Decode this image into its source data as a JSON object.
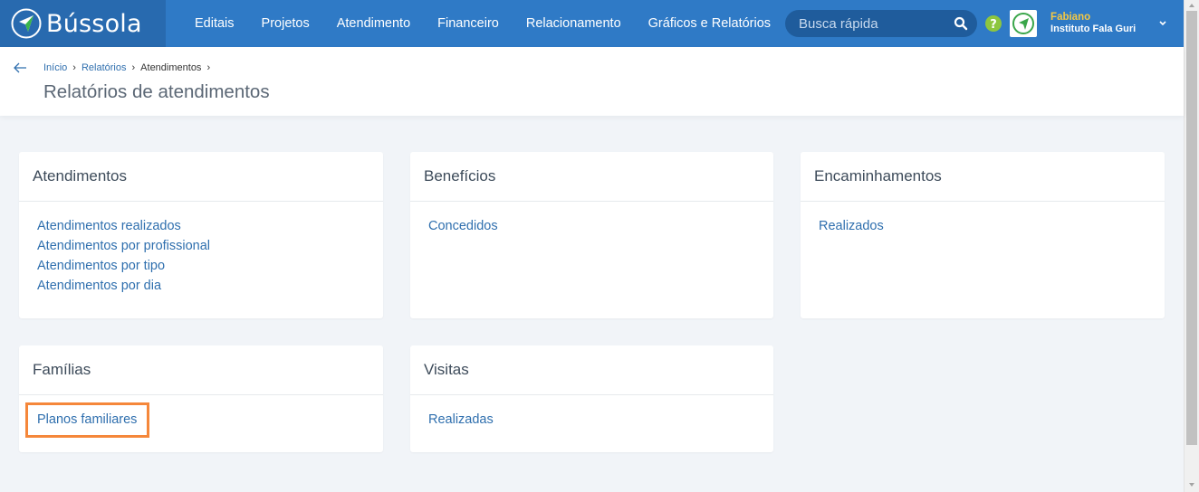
{
  "brand": {
    "name": "Bússola",
    "logo_icon": "compass-icon"
  },
  "nav": {
    "items": [
      "Editais",
      "Projetos",
      "Atendimento",
      "Financeiro",
      "Relacionamento",
      "Gráficos e Relatórios"
    ]
  },
  "search": {
    "placeholder": "Busca rápida",
    "icon": "search-icon"
  },
  "user": {
    "name": "Fabiano",
    "org": "Instituto Fala Guri"
  },
  "breadcrumb": {
    "items": [
      "Início",
      "Relatórios",
      "Atendimentos"
    ]
  },
  "page": {
    "title": "Relatórios de atendimentos"
  },
  "cards": [
    {
      "title": "Atendimentos",
      "links": [
        "Atendimentos realizados",
        "Atendimentos por profissional",
        "Atendimentos por tipo",
        "Atendimentos por dia"
      ]
    },
    {
      "title": "Benefícios",
      "links": [
        "Concedidos"
      ]
    },
    {
      "title": "Encaminhamentos",
      "links": [
        "Realizados"
      ]
    },
    {
      "title": "Famílias",
      "links": [
        "Planos familiares"
      ]
    },
    {
      "title": "Visitas",
      "links": [
        "Realizadas"
      ]
    }
  ],
  "colors": {
    "navbar": "#2f7ac6",
    "brand_bg": "#286aaf",
    "link": "#2f6fae",
    "highlight": "#f5873a",
    "user_name": "#f5c842"
  }
}
